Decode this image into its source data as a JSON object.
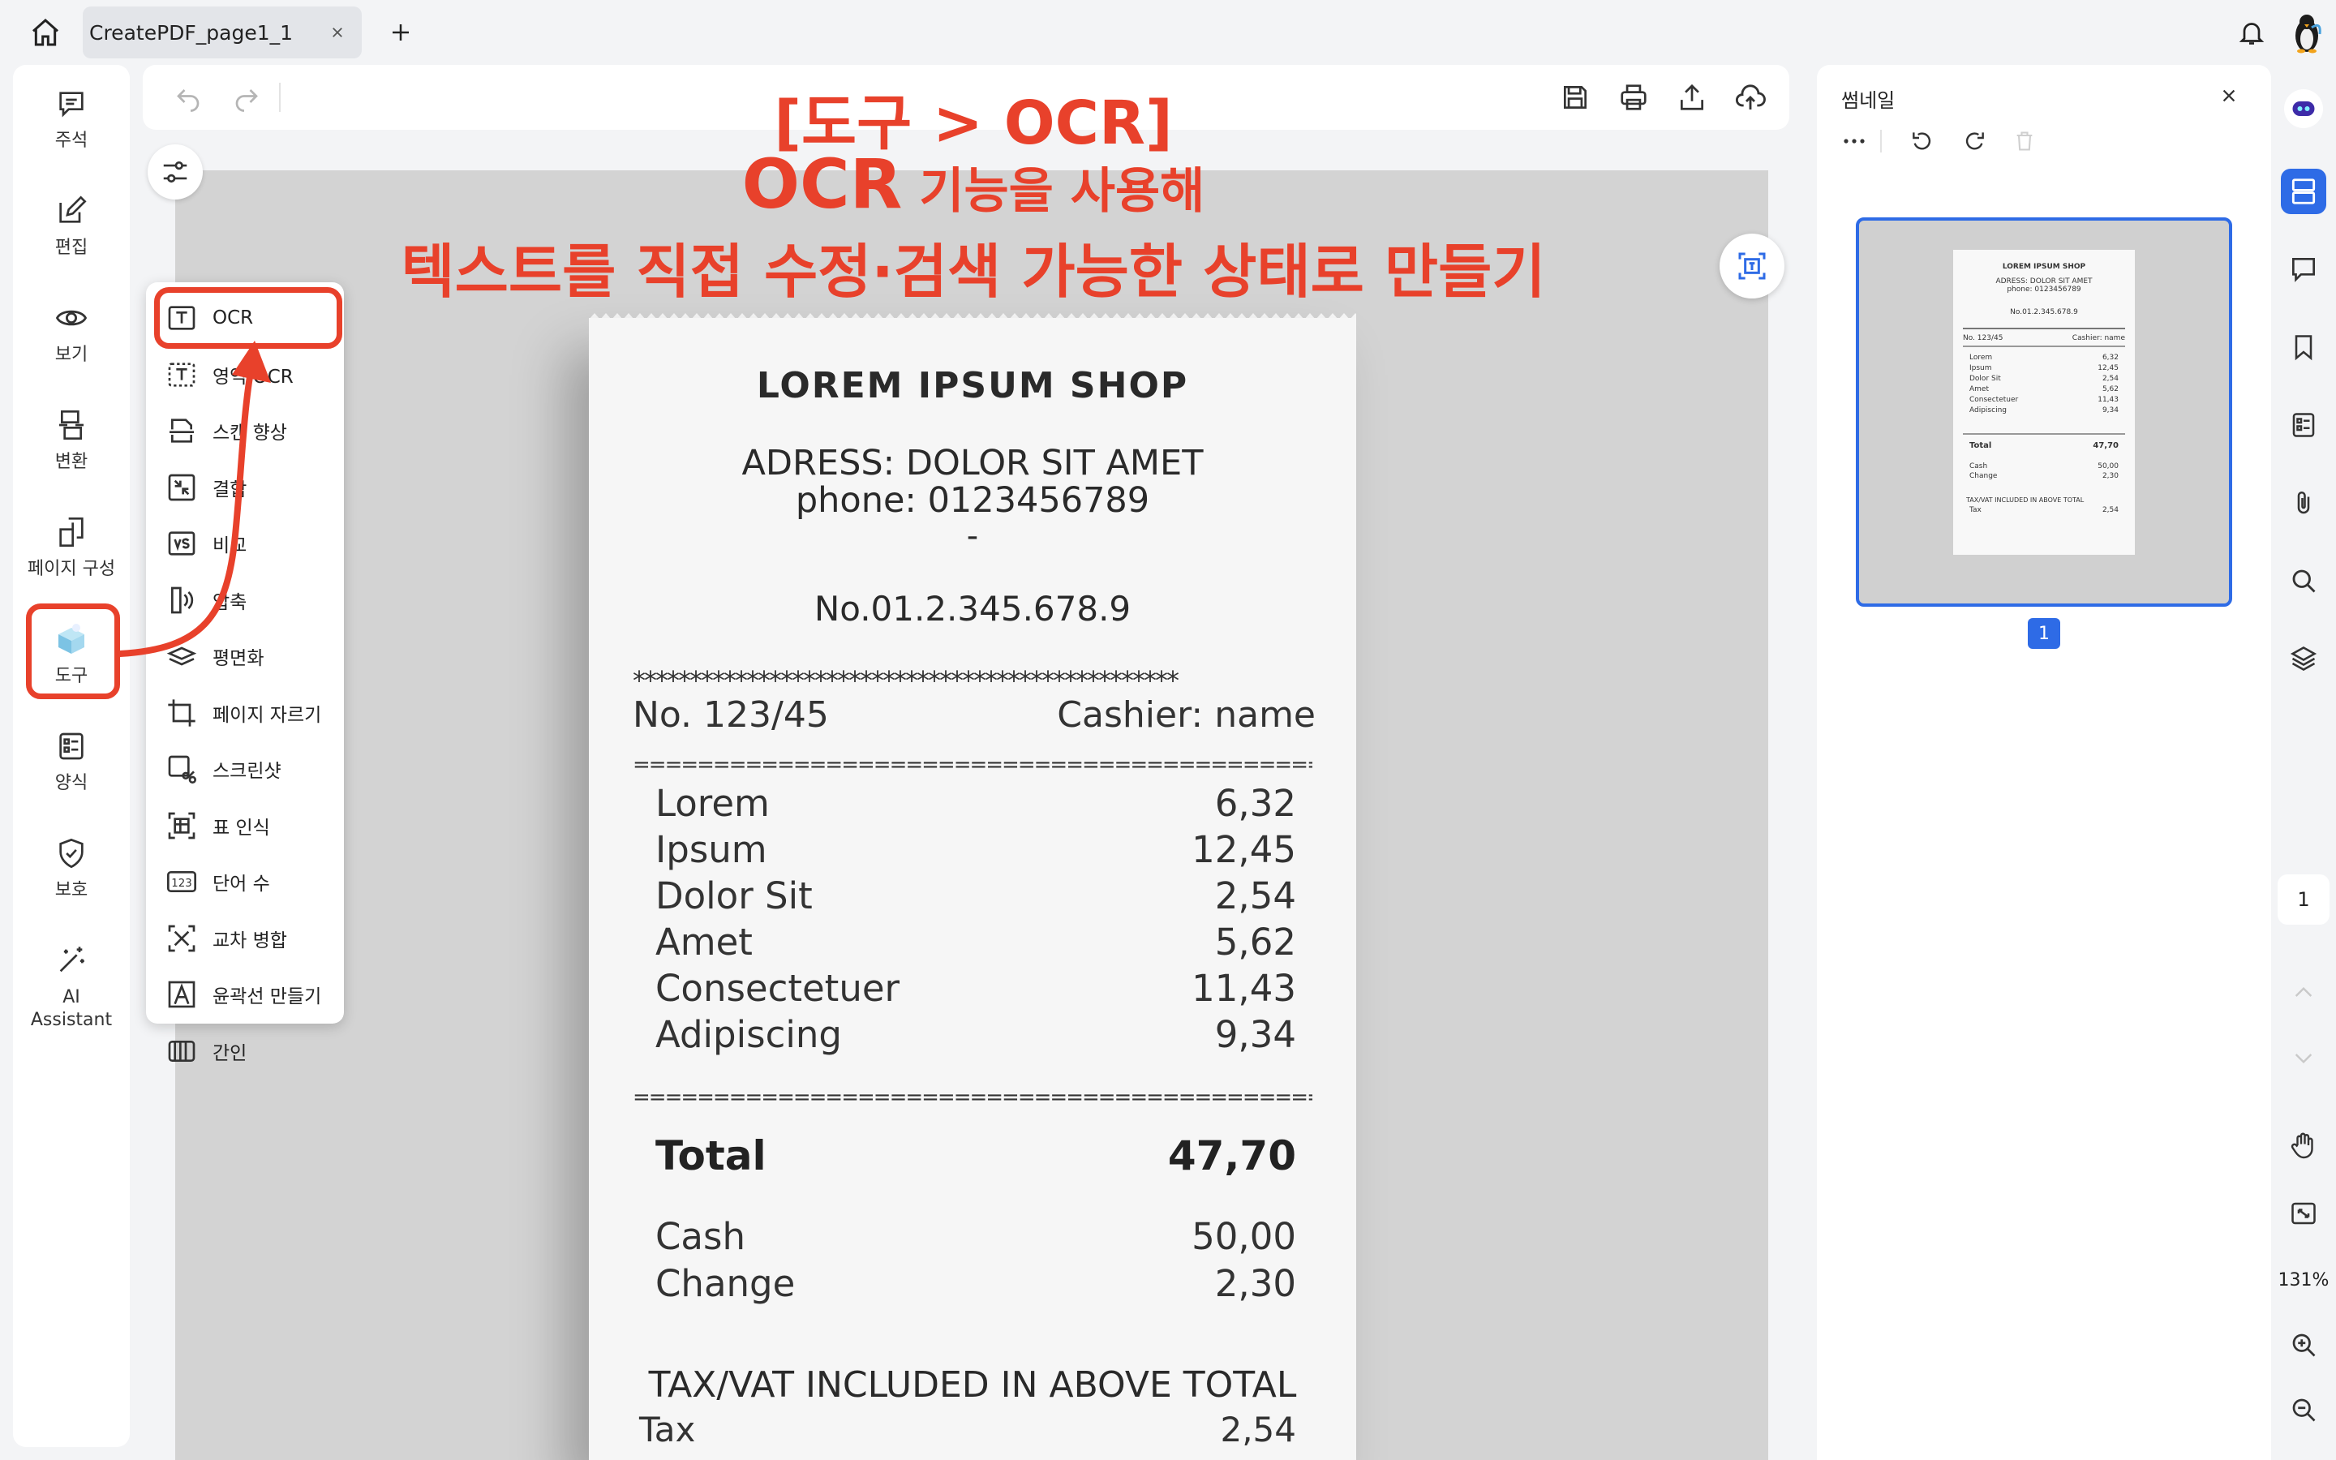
{
  "tab": {
    "title": "CreatePDF_page1_1"
  },
  "left_nav": {
    "comment": "주석",
    "edit": "편집",
    "view": "보기",
    "convert": "변환",
    "organize": "페이지 구성",
    "tools": "도구",
    "form": "양식",
    "protect": "보호",
    "ai": "AI\nAssistant"
  },
  "annotation": {
    "line1": "[도구 > OCR]",
    "line2_strong": "OCR",
    "line2_rest": " 기능을 사용해",
    "line3": "텍스트를 직접 수정·검색 가능한 상태로 만들기",
    "color": "#e8412b"
  },
  "tools_menu": {
    "items": [
      {
        "label": "OCR",
        "icon": "ocr-icon"
      },
      {
        "label": "영역 OCR",
        "icon": "area-ocr-icon"
      },
      {
        "label": "스캔 향상",
        "icon": "scan-enhance-icon"
      },
      {
        "label": "결합",
        "icon": "combine-icon"
      },
      {
        "label": "비교",
        "icon": "compare-icon"
      },
      {
        "label": "압축",
        "icon": "compress-icon"
      },
      {
        "label": "평면화",
        "icon": "flatten-icon"
      },
      {
        "label": "페이지 자르기",
        "icon": "crop-icon"
      },
      {
        "label": "스크린샷",
        "icon": "screenshot-icon"
      },
      {
        "label": "표 인식",
        "icon": "table-recognition-icon"
      },
      {
        "label": "단어 수",
        "icon": "word-count-icon"
      },
      {
        "label": "교차 병합",
        "icon": "cross-merge-icon"
      },
      {
        "label": "윤곽선 만들기",
        "icon": "outline-text-icon"
      },
      {
        "label": "간인",
        "icon": "seal-icon"
      }
    ]
  },
  "receipt": {
    "shop": "LOREM IPSUM SHOP",
    "address": "ADRESS: DOLOR SIT AMET",
    "phone": "phone: 0123456789",
    "dash": "-",
    "number": "No.01.2.345.678.9",
    "stars": "************************************************",
    "ticket_no": "No. 123/45",
    "cashier": "Cashier: name",
    "equals": "================================================================",
    "items": [
      {
        "name": "Lorem",
        "price": "6,32"
      },
      {
        "name": "Ipsum",
        "price": "12,45"
      },
      {
        "name": "Dolor Sit",
        "price": "2,54"
      },
      {
        "name": "Amet",
        "price": "5,62"
      },
      {
        "name": "Consectetuer",
        "price": "11,43"
      },
      {
        "name": "Adipiscing",
        "price": "9,34"
      }
    ],
    "total_label": "Total",
    "total_value": "47,70",
    "cash_label": "Cash",
    "cash_value": "50,00",
    "change_label": "Change",
    "change_value": "2,30",
    "tax_note": "TAX/VAT INCLUDED IN ABOVE TOTAL",
    "tax_label": "Tax",
    "tax_value": "2,54"
  },
  "thumbnail_panel": {
    "title": "썸네일",
    "page_badge": "1",
    "mini": {
      "shop": "LOREM IPSUM SHOP",
      "address": "ADRESS: DOLOR SIT AMET",
      "phone": "phone: 0123456789",
      "number": "No.01.2.345.678.9",
      "ticket_no": "No. 123/45",
      "cashier": "Cashier: name",
      "total_label": "Total",
      "total_value": "47,70",
      "cash_label": "Cash",
      "cash_value": "50,00",
      "change_label": "Change",
      "change_value": "2,30",
      "tax_note": "TAX/VAT INCLUDED IN ABOVE TOTAL",
      "tax_label": "Tax",
      "tax_value": "2,54"
    }
  },
  "right_bar": {
    "page_number": "1",
    "zoom": "131%"
  }
}
